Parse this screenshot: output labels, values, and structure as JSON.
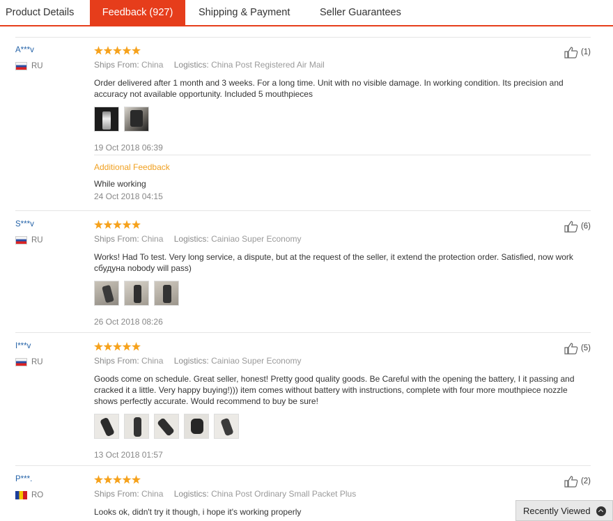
{
  "tabs": [
    {
      "label": "Product Details"
    },
    {
      "label": "Feedback (927)"
    },
    {
      "label": "Shipping & Payment"
    },
    {
      "label": "Seller Guarantees"
    }
  ],
  "colors": {
    "accent": "#e63d1b",
    "star": "#f6a21c",
    "additional": "#f0a020",
    "username": "#2563a8"
  },
  "reviews": [
    {
      "user": "A***v",
      "country": "RU",
      "rating": 5,
      "helpful": "(1)",
      "ships_label": "Ships From:",
      "ships_from": "China",
      "logistics_label": "Logistics:",
      "logistics": "China Post Registered Air Mail",
      "text": "Order delivered after 1 month and 3 weeks. For a long time. Unit with no visible damage. In working condition. Its precision and accuracy not available opportunity. Included 5 mouthpieces",
      "date": "19 Oct 2018 06:39",
      "additional": {
        "title": "Additional Feedback",
        "text": "While working",
        "date": "24 Oct 2018 04:15"
      }
    },
    {
      "user": "S***v",
      "country": "RU",
      "rating": 5,
      "helpful": "(6)",
      "ships_label": "Ships From:",
      "ships_from": "China",
      "logistics_label": "Logistics:",
      "logistics": "Cainiao Super Economy",
      "text": "Works! Had To test. Very long service, a dispute, but at the request of the seller, it extend the protection order. Satisfied, now work сбудуна nobody will pass)",
      "date": "26 Oct 2018 08:26"
    },
    {
      "user": "I***v",
      "country": "RU",
      "rating": 5,
      "helpful": "(5)",
      "ships_label": "Ships From:",
      "ships_from": "China",
      "logistics_label": "Logistics:",
      "logistics": "Cainiao Super Economy",
      "text": "Goods come on schedule. Great seller, honest! Pretty good quality goods. Be Careful with the opening the battery, I it passing and cracked it a little. Very happy buying!))) item comes without battery with instructions, complete with four more mouthpiece nozzle shows perfectly accurate. Would recommend to buy be sure!",
      "date": "13 Oct 2018 01:57"
    },
    {
      "user": "P***.",
      "country": "RO",
      "rating": 5,
      "helpful": "(2)",
      "ships_label": "Ships From:",
      "ships_from": "China",
      "logistics_label": "Logistics:",
      "logistics": "China Post Ordinary Small Packet Plus",
      "text": "Looks ok, didn't try it though, i hope it's working properly"
    }
  ],
  "recently_viewed": "Recently Viewed"
}
